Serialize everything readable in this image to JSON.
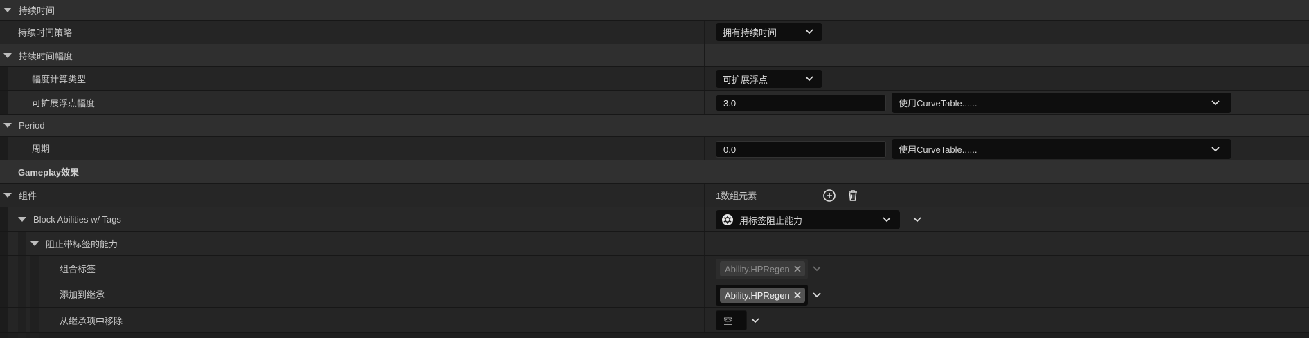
{
  "sections": {
    "duration": {
      "label": "持续时间"
    },
    "duration_policy": {
      "label": "持续时间策略",
      "value": "拥有持续时间"
    },
    "duration_magnitude": {
      "label": "持续时间幅度"
    },
    "magnitude_calc_type": {
      "label": "幅度计算类型",
      "value": "可扩展浮点"
    },
    "scalable_float_magnitude": {
      "label": "可扩展浮点幅度",
      "value": "3.0",
      "curve": "使用CurveTable......"
    },
    "period_section": {
      "label": "Period"
    },
    "period": {
      "label": "周期",
      "value": "0.0",
      "curve": "使用CurveTable......"
    },
    "gameplay_effect": {
      "label": "Gameplay效果"
    },
    "components": {
      "label": "组件",
      "count": "1数组元素"
    },
    "block_abilities": {
      "label": "Block Abilities w/ Tags",
      "value": "用标签阻止能力"
    },
    "block_tagged": {
      "label": "阻止带标签的能力"
    },
    "combined_tags": {
      "label": "组合标签",
      "tag": "Ability.HPRegen"
    },
    "added_inherit": {
      "label": "添加到继承",
      "tag": "Ability.HPRegen"
    },
    "remove_inherit": {
      "label": "从继承项中移除",
      "value": "空"
    }
  },
  "icons": {
    "expand": "triangle-down-icon",
    "dropdown": "chevron-down-icon",
    "add": "plus-circle-icon",
    "delete": "trash-icon",
    "remove_tag": "close-icon",
    "component": "gear-icon"
  }
}
